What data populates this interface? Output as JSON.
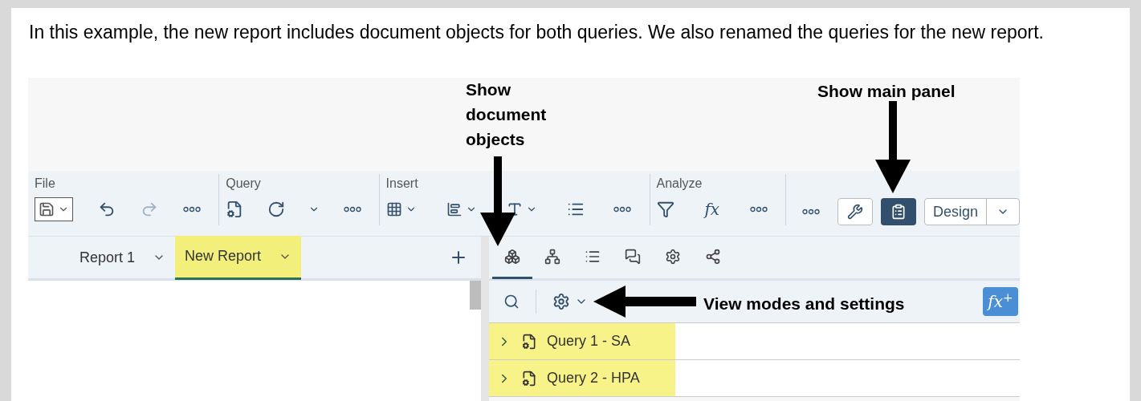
{
  "intro": "In this example, the new report includes document objects for both queries. We also renamed the queries for the new report.",
  "annotations": [
    {
      "text": "Show document objects"
    },
    {
      "text": "Show main panel"
    },
    {
      "text": "View modes and settings"
    }
  ],
  "toolbar": {
    "groups": [
      {
        "label": "File",
        "items": [
          {
            "kind": "save"
          },
          {
            "kind": "undo",
            "disabled": false
          },
          {
            "kind": "redo",
            "disabled": true
          },
          {
            "kind": "more"
          }
        ]
      },
      {
        "label": "Query",
        "items": [
          {
            "kind": "query-grid"
          },
          {
            "kind": "refresh"
          },
          {
            "kind": "caret"
          },
          {
            "kind": "more"
          }
        ]
      },
      {
        "label": "Insert",
        "items": [
          {
            "kind": "table"
          },
          {
            "kind": "chart"
          },
          {
            "kind": "text"
          },
          {
            "kind": "list"
          },
          {
            "kind": "more"
          }
        ]
      },
      {
        "label": "Analyze",
        "items": [
          {
            "kind": "filter"
          },
          {
            "kind": "formula",
            "label": "fx"
          },
          {
            "kind": "more"
          }
        ]
      }
    ],
    "tools_button": {
      "selected": false
    },
    "main_panel_button": {
      "selected": true
    },
    "mode_button": {
      "label": "Design"
    }
  },
  "report_tabs": [
    {
      "label": "Report 1",
      "selected": false,
      "highlighted": false
    },
    {
      "label": "New Report",
      "selected": true,
      "highlighted": true
    }
  ],
  "side_tabs": [
    {
      "kind": "objects",
      "selected": true
    },
    {
      "kind": "tree",
      "selected": false
    },
    {
      "kind": "list",
      "selected": false
    },
    {
      "kind": "comments",
      "selected": false
    },
    {
      "kind": "settings",
      "selected": false
    },
    {
      "kind": "share",
      "selected": false
    }
  ],
  "formula_button": {
    "label": "fx$^{+}$"
  },
  "queries": [
    {
      "label": "Query 1 - SA",
      "expanded": false,
      "highlighted": true
    },
    {
      "label": "Query 2 - HPA",
      "expanded": false,
      "highlighted": true
    }
  ]
}
